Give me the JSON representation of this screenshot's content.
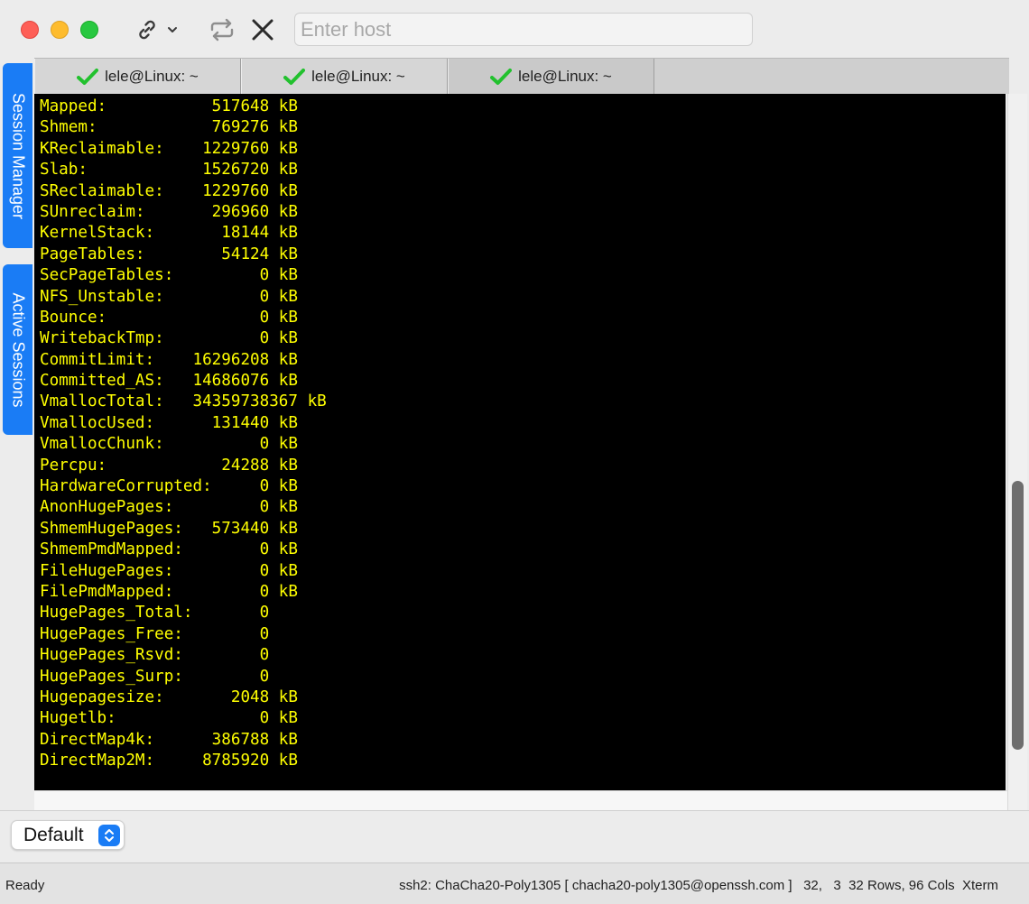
{
  "toolbar": {
    "host_placeholder": "Enter host"
  },
  "sidebar": {
    "tabs": [
      {
        "label": "Session Manager"
      },
      {
        "label": "Active Sessions"
      }
    ]
  },
  "tabs": [
    {
      "label": "lele@Linux: ~",
      "status": "connected"
    },
    {
      "label": "lele@Linux: ~",
      "status": "connected"
    },
    {
      "label": "lele@Linux: ~",
      "status": "connected",
      "active": true
    }
  ],
  "terminal": {
    "text_color": "#ffff00",
    "background": "#000000",
    "lines": [
      "Mapped:           517648 kB",
      "Shmem:            769276 kB",
      "KReclaimable:    1229760 kB",
      "Slab:            1526720 kB",
      "SReclaimable:    1229760 kB",
      "SUnreclaim:       296960 kB",
      "KernelStack:       18144 kB",
      "PageTables:        54124 kB",
      "SecPageTables:         0 kB",
      "NFS_Unstable:          0 kB",
      "Bounce:                0 kB",
      "WritebackTmp:          0 kB",
      "CommitLimit:    16296208 kB",
      "Committed_AS:   14686076 kB",
      "VmallocTotal:   34359738367 kB",
      "VmallocUsed:      131440 kB",
      "VmallocChunk:          0 kB",
      "Percpu:            24288 kB",
      "HardwareCorrupted:     0 kB",
      "AnonHugePages:         0 kB",
      "ShmemHugePages:   573440 kB",
      "ShmemPmdMapped:        0 kB",
      "FileHugePages:         0 kB",
      "FilePmdMapped:         0 kB",
      "HugePages_Total:       0",
      "HugePages_Free:        0",
      "HugePages_Rsvd:        0",
      "HugePages_Surp:        0",
      "Hugepagesize:       2048 kB",
      "Hugetlb:               0 kB",
      "DirectMap4k:      386788 kB",
      "DirectMap2M:     8785920 kB"
    ]
  },
  "profile_select": {
    "value": "Default"
  },
  "status_bar": {
    "left": "Ready",
    "right": "ssh2: ChaCha20-Poly1305 [ chacha20-poly1305@openssh.com ]   32,   3  32 Rows, 96 Cols  Xterm"
  },
  "icons": {
    "link": "link-icon",
    "repeat": "repeat-icon",
    "close": "close-icon",
    "check": "check-icon",
    "stepper": "chevron-updown-icon"
  }
}
